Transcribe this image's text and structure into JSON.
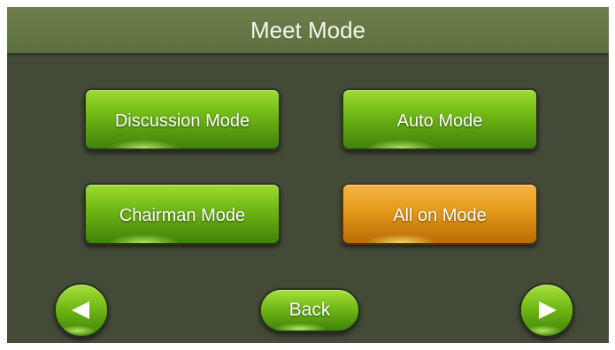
{
  "header": {
    "title": "Meet Mode"
  },
  "modes": {
    "discussion": "Discussion Mode",
    "auto": "Auto Mode",
    "chairman": "Chairman Mode",
    "all_on": "All on Mode"
  },
  "selected_mode": "All on Mode",
  "nav": {
    "back_label": "Back",
    "prev_icon": "left-arrow-icon",
    "next_icon": "right-arrow-icon"
  },
  "colors": {
    "background": "#434a38",
    "header": "#687a47",
    "button_green": "#6db514",
    "button_selected_orange": "#e39a18"
  }
}
